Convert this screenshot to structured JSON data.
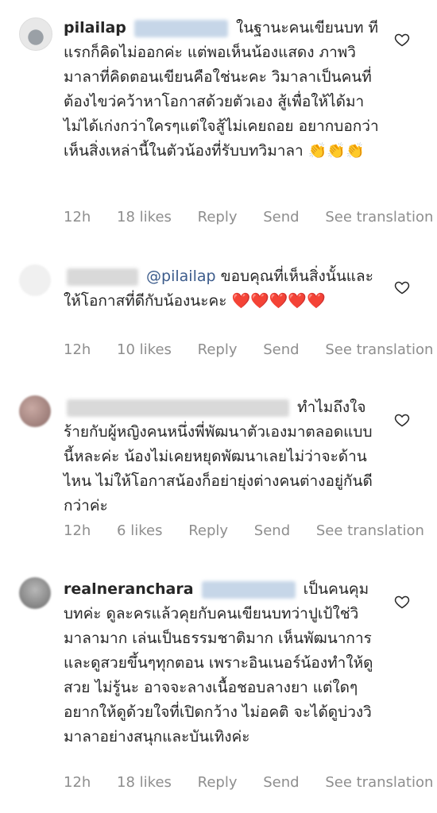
{
  "comments": [
    {
      "username": "pilailap",
      "text": "ในฐานะคนเขียนบท ทีแรกก็คิดไม่ออกค่ะ แต่พอเห็นน้องแสดง ภาพวิมาลาที่คิดตอนเขียนคือใช่นะคะ วิมาลาเป็นคนที่ต้องไขว่คว้าหาโอกาสด้วยตัวเอง สู้เพื่อให้ได้มา ไม่ได้เก่งกว่าใครๆแต่ใจสู้ไม่เคยถอย อยากบอกว่าเห็นสิ่งเหล่านี้ในตัวน้องที่รับบทวิมาลา",
      "emojis": "👏👏👏",
      "time": "12h",
      "likes": "18 likes",
      "reply": "Reply",
      "send": "Send",
      "translation": "See translation"
    },
    {
      "mention": "@pilailap",
      "text": "ขอบคุณที่เห็นสิ่งนั้นและให้โอกาสที่ดีกับน้องนะคะ",
      "emojis": "❤️❤️❤️❤️❤️",
      "time": "12h",
      "likes": "10 likes",
      "reply": "Reply",
      "send": "Send",
      "translation": "See translation"
    },
    {
      "text": "ทำไมถึงใจร้ายกับผู้หญิงคนหนึ่งพี่พัฒนาตัวเองมาตลอดแบบนี้หละค่ะ น้องไม่เคยหยุดพัฒนาเลยไม่ว่าจะด้านไหน ไม่ให้โอกาสน้องก็อย่ายุ่งต่างคนต่างอยู่กันดีกว่าค่ะ",
      "time": "12h",
      "likes": "6 likes",
      "reply": "Reply",
      "send": "Send",
      "translation": "See translation"
    },
    {
      "username": "realneranchara",
      "text": "เป็นคนคุมบทค่ะ ดูละครแล้วคุยกับคนเขียนบทว่าปูเป้ใช่วิมาลามาก เล่นเป็นธรรมชาติมาก เห็นพัฒนาการ และดูสวยขึ้นๆทุกตอน เพราะอินเนอร์น้องทำให้ดูสวย ไม่รู้นะ อาจจะลางเนื้อชอบลางยา แต่ใดๆ อยากให้ดูด้วยใจที่เปิดกว้าง ไม่อคติ จะได้ดูบ่วงวิมาลาอย่างสนุกและบันเทิงค่ะ",
      "time": "12h",
      "likes": "18 likes",
      "reply": "Reply",
      "send": "Send",
      "translation": "See translation"
    }
  ]
}
